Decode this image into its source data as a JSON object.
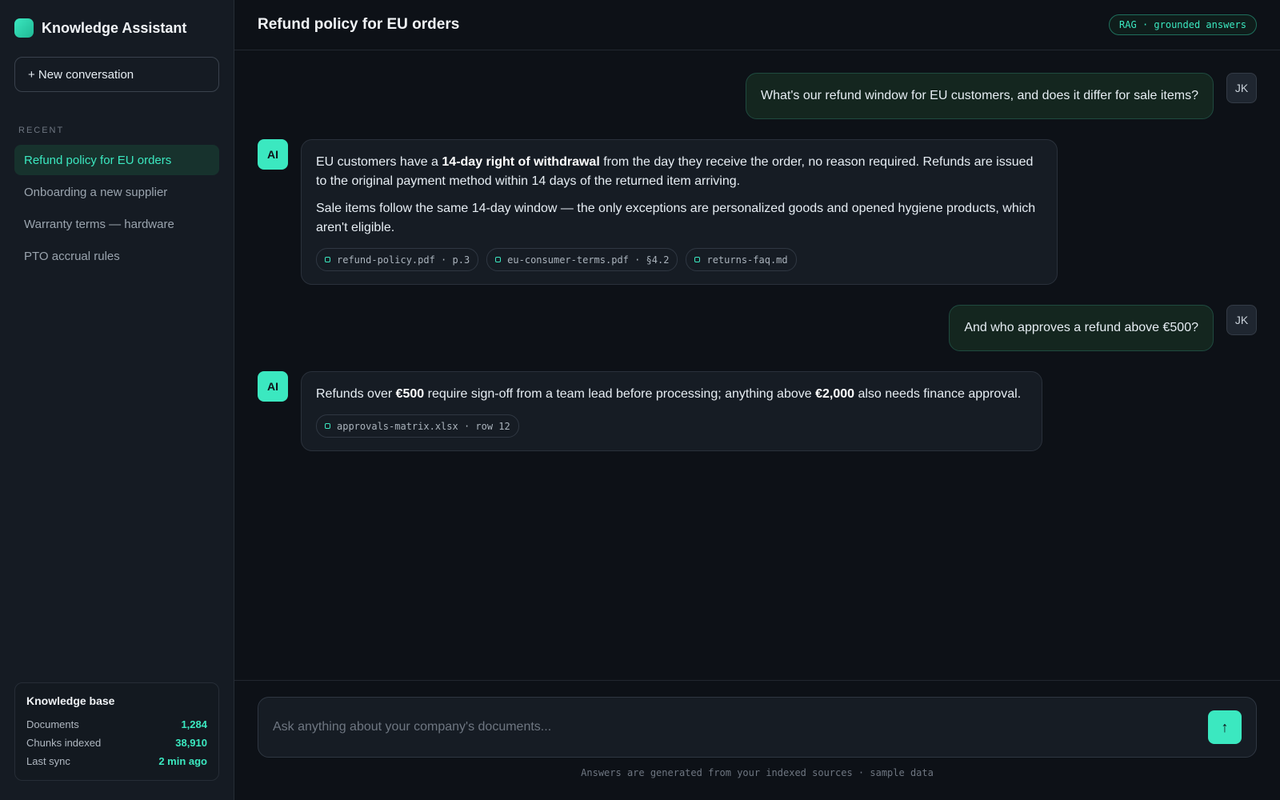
{
  "brand": {
    "name": "Knowledge Assistant"
  },
  "sidebar": {
    "new_conversation_label": "+ New conversation",
    "recent_label": "RECENT",
    "conversations": [
      {
        "label": "Refund policy for EU orders",
        "active": true
      },
      {
        "label": "Onboarding a new supplier",
        "active": false
      },
      {
        "label": "Warranty terms — hardware",
        "active": false
      },
      {
        "label": "PTO accrual rules",
        "active": false
      }
    ],
    "knowledge_base": {
      "title": "Knowledge base",
      "stats": [
        {
          "label": "Documents",
          "value": "1,284"
        },
        {
          "label": "Chunks indexed",
          "value": "38,910"
        },
        {
          "label": "Last sync",
          "value": "2 min ago"
        }
      ]
    }
  },
  "header": {
    "title": "Refund policy for EU orders",
    "badge": "RAG · grounded answers"
  },
  "messages": [
    {
      "role": "user",
      "avatar": "JK",
      "text": "What's our refund window for EU customers, and does it differ for sale items?"
    },
    {
      "role": "ai",
      "avatar": "AI",
      "paragraphs": [
        [
          {
            "t": "EU customers have a "
          },
          {
            "t": "14-day right of withdrawal",
            "bold": true
          },
          {
            "t": " from the day they receive the order, no reason required. Refunds are issued to the original payment method within 14 days of the returned item arriving."
          }
        ],
        [
          {
            "t": "Sale items follow the same 14-day window — the only exceptions are personalized goods and opened hygiene products, which aren't eligible."
          }
        ]
      ],
      "sources": [
        "refund-policy.pdf · p.3",
        "eu-consumer-terms.pdf · §4.2",
        "returns-faq.md"
      ]
    },
    {
      "role": "user",
      "avatar": "JK",
      "text": "And who approves a refund above €500?"
    },
    {
      "role": "ai",
      "avatar": "AI",
      "paragraphs": [
        [
          {
            "t": "Refunds over "
          },
          {
            "t": "€500",
            "bold": true
          },
          {
            "t": " require sign-off from a team lead before processing; anything above "
          },
          {
            "t": "€2,000",
            "bold": true
          },
          {
            "t": " also needs finance approval."
          }
        ]
      ],
      "sources": [
        "approvals-matrix.xlsx · row 12"
      ]
    }
  ],
  "composer": {
    "placeholder": "Ask anything about your company's documents...",
    "send_icon": "arrow-up-icon",
    "send_glyph": "↑",
    "footnote": "Answers are generated from your indexed sources · sample data"
  },
  "colors": {
    "accent": "#3be8c0",
    "background": "#0d1117",
    "sidebar": "#151b23"
  }
}
